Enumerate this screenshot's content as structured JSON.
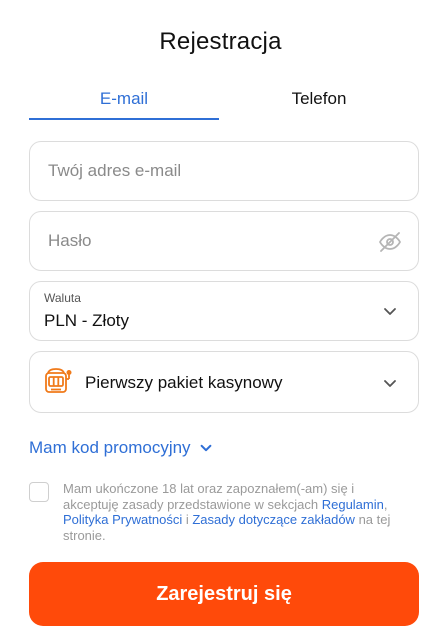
{
  "page": {
    "title": "Rejestracja"
  },
  "tabs": [
    {
      "label": "E-mail",
      "active": true
    },
    {
      "label": "Telefon",
      "active": false
    }
  ],
  "form": {
    "email_placeholder": "Twój adres e-mail",
    "password_placeholder": "Hasło",
    "password_icon": "eye-off-icon",
    "currency_label": "Waluta",
    "currency_value": "PLN - Złoty",
    "bonus_icon": "slot-machine-icon",
    "bonus_value": "Pierwszy pakiet kasynowy",
    "promo_label": "Mam kod promocyjny"
  },
  "consent": {
    "text_1": "Mam ukończone 18 lat oraz zapoznałem(-am) się i akceptuję zasady przedstawione w sekcjach",
    "link_1": "Regulamin",
    "sep_1": ",",
    "link_2": "Polityka Prywatności",
    "sep_2": "i",
    "link_3": "Zasady dotyczące zakładów",
    "text_2": "na tej stronie."
  },
  "submit": {
    "label": "Zarejestruj się"
  },
  "colors": {
    "accent": "#2f6fd6",
    "primary_button": "#ff4a0a",
    "slot_icon": "#f07a1a"
  }
}
